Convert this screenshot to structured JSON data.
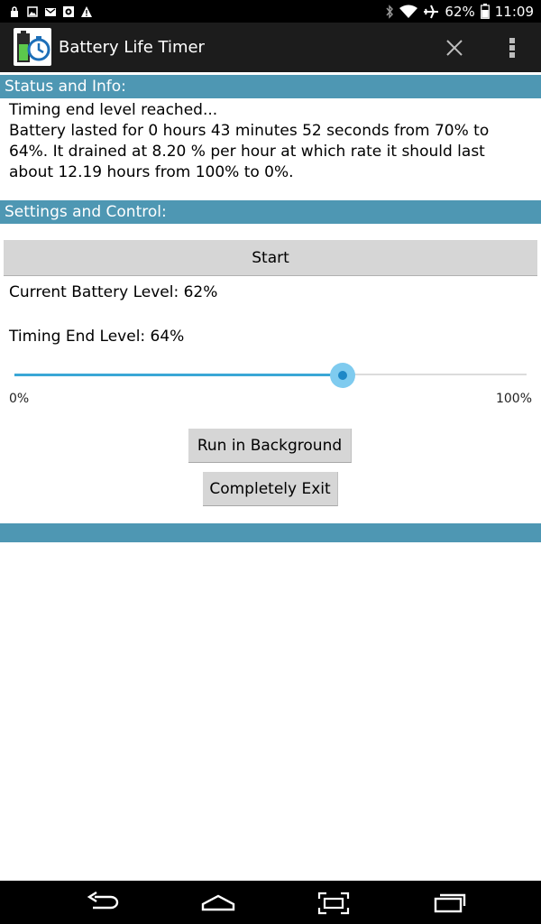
{
  "status_bar": {
    "battery_percent": "62%",
    "time": "11:09",
    "icons_left": [
      "lock-icon",
      "image-icon",
      "gmail-icon",
      "app-notification-icon",
      "warning-icon"
    ],
    "icons_right": [
      "bluetooth-icon",
      "wifi-icon",
      "airplane-icon",
      "battery-icon"
    ]
  },
  "action_bar": {
    "title": "Battery Life Timer",
    "icons": [
      "app-icon",
      "close-icon",
      "overflow-menu-icon"
    ]
  },
  "sections": {
    "status_header": "Status and Info:",
    "settings_header": "Settings and Control:"
  },
  "status": {
    "line1": "Timing end level reached...",
    "line2": "Battery lasted for 0 hours 43 minutes 52 seconds  from 70% to 64%. It drained at 8.20 % per hour at which rate it should last about 12.19 hours from 100% to 0%."
  },
  "controls": {
    "start_label": "Start",
    "current_level": "Current Battery Level: 62%",
    "end_level": "Timing End Level: 64%",
    "slider_value": 64,
    "slider_min_label": "0%",
    "slider_max_label": "100%",
    "run_background_label": "Run in Background",
    "exit_label": "Completely Exit"
  },
  "colors": {
    "section_header": "#4e97b3",
    "slider_accent": "#3aa7d6",
    "button_bg": "#d6d6d6"
  },
  "nav_bar": {
    "icons": [
      "back-icon",
      "home-icon",
      "screenshot-icon",
      "recents-icon"
    ]
  }
}
